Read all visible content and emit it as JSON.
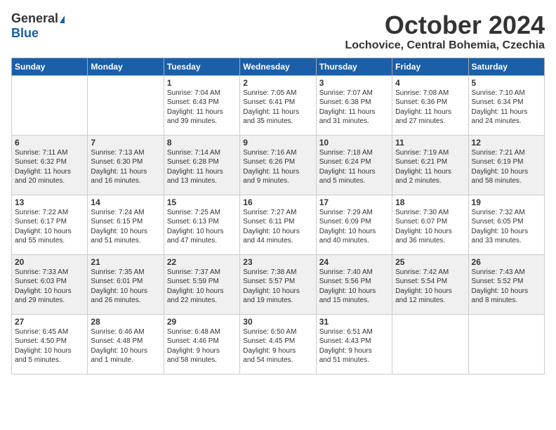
{
  "header": {
    "logo_general": "General",
    "logo_blue": "Blue",
    "month": "October 2024",
    "location": "Lochovice, Central Bohemia, Czechia"
  },
  "weekdays": [
    "Sunday",
    "Monday",
    "Tuesday",
    "Wednesday",
    "Thursday",
    "Friday",
    "Saturday"
  ],
  "weeks": [
    [
      {
        "day": "",
        "info": ""
      },
      {
        "day": "",
        "info": ""
      },
      {
        "day": "1",
        "info": "Sunrise: 7:04 AM\nSunset: 6:43 PM\nDaylight: 11 hours\nand 39 minutes."
      },
      {
        "day": "2",
        "info": "Sunrise: 7:05 AM\nSunset: 6:41 PM\nDaylight: 11 hours\nand 35 minutes."
      },
      {
        "day": "3",
        "info": "Sunrise: 7:07 AM\nSunset: 6:38 PM\nDaylight: 11 hours\nand 31 minutes."
      },
      {
        "day": "4",
        "info": "Sunrise: 7:08 AM\nSunset: 6:36 PM\nDaylight: 11 hours\nand 27 minutes."
      },
      {
        "day": "5",
        "info": "Sunrise: 7:10 AM\nSunset: 6:34 PM\nDaylight: 11 hours\nand 24 minutes."
      }
    ],
    [
      {
        "day": "6",
        "info": "Sunrise: 7:11 AM\nSunset: 6:32 PM\nDaylight: 11 hours\nand 20 minutes."
      },
      {
        "day": "7",
        "info": "Sunrise: 7:13 AM\nSunset: 6:30 PM\nDaylight: 11 hours\nand 16 minutes."
      },
      {
        "day": "8",
        "info": "Sunrise: 7:14 AM\nSunset: 6:28 PM\nDaylight: 11 hours\nand 13 minutes."
      },
      {
        "day": "9",
        "info": "Sunrise: 7:16 AM\nSunset: 6:26 PM\nDaylight: 11 hours\nand 9 minutes."
      },
      {
        "day": "10",
        "info": "Sunrise: 7:18 AM\nSunset: 6:24 PM\nDaylight: 11 hours\nand 5 minutes."
      },
      {
        "day": "11",
        "info": "Sunrise: 7:19 AM\nSunset: 6:21 PM\nDaylight: 11 hours\nand 2 minutes."
      },
      {
        "day": "12",
        "info": "Sunrise: 7:21 AM\nSunset: 6:19 PM\nDaylight: 10 hours\nand 58 minutes."
      }
    ],
    [
      {
        "day": "13",
        "info": "Sunrise: 7:22 AM\nSunset: 6:17 PM\nDaylight: 10 hours\nand 55 minutes."
      },
      {
        "day": "14",
        "info": "Sunrise: 7:24 AM\nSunset: 6:15 PM\nDaylight: 10 hours\nand 51 minutes."
      },
      {
        "day": "15",
        "info": "Sunrise: 7:25 AM\nSunset: 6:13 PM\nDaylight: 10 hours\nand 47 minutes."
      },
      {
        "day": "16",
        "info": "Sunrise: 7:27 AM\nSunset: 6:11 PM\nDaylight: 10 hours\nand 44 minutes."
      },
      {
        "day": "17",
        "info": "Sunrise: 7:29 AM\nSunset: 6:09 PM\nDaylight: 10 hours\nand 40 minutes."
      },
      {
        "day": "18",
        "info": "Sunrise: 7:30 AM\nSunset: 6:07 PM\nDaylight: 10 hours\nand 36 minutes."
      },
      {
        "day": "19",
        "info": "Sunrise: 7:32 AM\nSunset: 6:05 PM\nDaylight: 10 hours\nand 33 minutes."
      }
    ],
    [
      {
        "day": "20",
        "info": "Sunrise: 7:33 AM\nSunset: 6:03 PM\nDaylight: 10 hours\nand 29 minutes."
      },
      {
        "day": "21",
        "info": "Sunrise: 7:35 AM\nSunset: 6:01 PM\nDaylight: 10 hours\nand 26 minutes."
      },
      {
        "day": "22",
        "info": "Sunrise: 7:37 AM\nSunset: 5:59 PM\nDaylight: 10 hours\nand 22 minutes."
      },
      {
        "day": "23",
        "info": "Sunrise: 7:38 AM\nSunset: 5:57 PM\nDaylight: 10 hours\nand 19 minutes."
      },
      {
        "day": "24",
        "info": "Sunrise: 7:40 AM\nSunset: 5:56 PM\nDaylight: 10 hours\nand 15 minutes."
      },
      {
        "day": "25",
        "info": "Sunrise: 7:42 AM\nSunset: 5:54 PM\nDaylight: 10 hours\nand 12 minutes."
      },
      {
        "day": "26",
        "info": "Sunrise: 7:43 AM\nSunset: 5:52 PM\nDaylight: 10 hours\nand 8 minutes."
      }
    ],
    [
      {
        "day": "27",
        "info": "Sunrise: 6:45 AM\nSunset: 4:50 PM\nDaylight: 10 hours\nand 5 minutes."
      },
      {
        "day": "28",
        "info": "Sunrise: 6:46 AM\nSunset: 4:48 PM\nDaylight: 10 hours\nand 1 minute."
      },
      {
        "day": "29",
        "info": "Sunrise: 6:48 AM\nSunset: 4:46 PM\nDaylight: 9 hours\nand 58 minutes."
      },
      {
        "day": "30",
        "info": "Sunrise: 6:50 AM\nSunset: 4:45 PM\nDaylight: 9 hours\nand 54 minutes."
      },
      {
        "day": "31",
        "info": "Sunrise: 6:51 AM\nSunset: 4:43 PM\nDaylight: 9 hours\nand 51 minutes."
      },
      {
        "day": "",
        "info": ""
      },
      {
        "day": "",
        "info": ""
      }
    ]
  ]
}
